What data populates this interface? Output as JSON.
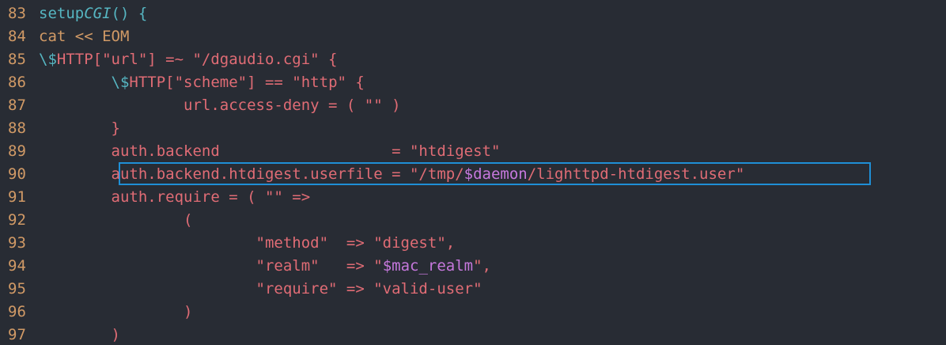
{
  "highlight_color": "#1f8fd6",
  "lines": [
    {
      "n": "83",
      "segs": [
        {
          "t": "setup",
          "c": "c-func"
        },
        {
          "t": "CGI",
          "c": "c-fname"
        },
        {
          "t": "() {",
          "c": "c-func"
        }
      ]
    },
    {
      "n": "84",
      "segs": [
        {
          "t": "cat << EOM",
          "c": "c-kw"
        }
      ]
    },
    {
      "n": "85",
      "segs": [
        {
          "t": "\\$",
          "c": "c-esc"
        },
        {
          "t": "HTTP[\"url\"] =~ \"/dgaudio.cgi\" {",
          "c": "c-str"
        }
      ]
    },
    {
      "n": "86",
      "segs": [
        {
          "t": "        ",
          "c": "c-str"
        },
        {
          "t": "\\$",
          "c": "c-esc"
        },
        {
          "t": "HTTP[\"scheme\"] == \"http\" {",
          "c": "c-str"
        }
      ]
    },
    {
      "n": "87",
      "segs": [
        {
          "t": "                url.access-deny = ( \"\" )",
          "c": "c-str"
        }
      ]
    },
    {
      "n": "88",
      "segs": [
        {
          "t": "        }",
          "c": "c-str"
        }
      ]
    },
    {
      "n": "89",
      "segs": [
        {
          "t": "        auth.backend                   = \"htdigest\"",
          "c": "c-str"
        }
      ]
    },
    {
      "n": "90",
      "segs": [
        {
          "t": "        auth.backend.htdigest.userfile = \"/tmp/",
          "c": "c-str"
        },
        {
          "t": "$daemon",
          "c": "c-var"
        },
        {
          "t": "/lighttpd-htdigest.user\"",
          "c": "c-str"
        }
      ]
    },
    {
      "n": "91",
      "segs": [
        {
          "t": "        auth.require = ( \"\" =>",
          "c": "c-str"
        }
      ]
    },
    {
      "n": "92",
      "segs": [
        {
          "t": "                (",
          "c": "c-str"
        }
      ]
    },
    {
      "n": "93",
      "segs": [
        {
          "t": "                        \"method\"  => \"digest\",",
          "c": "c-str"
        }
      ]
    },
    {
      "n": "94",
      "segs": [
        {
          "t": "                        \"realm\"   => \"",
          "c": "c-str"
        },
        {
          "t": "$mac_realm",
          "c": "c-var"
        },
        {
          "t": "\",",
          "c": "c-str"
        }
      ]
    },
    {
      "n": "95",
      "segs": [
        {
          "t": "                        \"require\" => \"valid-user\"",
          "c": "c-str"
        }
      ]
    },
    {
      "n": "96",
      "segs": [
        {
          "t": "                )",
          "c": "c-str"
        }
      ]
    },
    {
      "n": "97",
      "segs": [
        {
          "t": "        )",
          "c": "c-str"
        }
      ]
    }
  ]
}
